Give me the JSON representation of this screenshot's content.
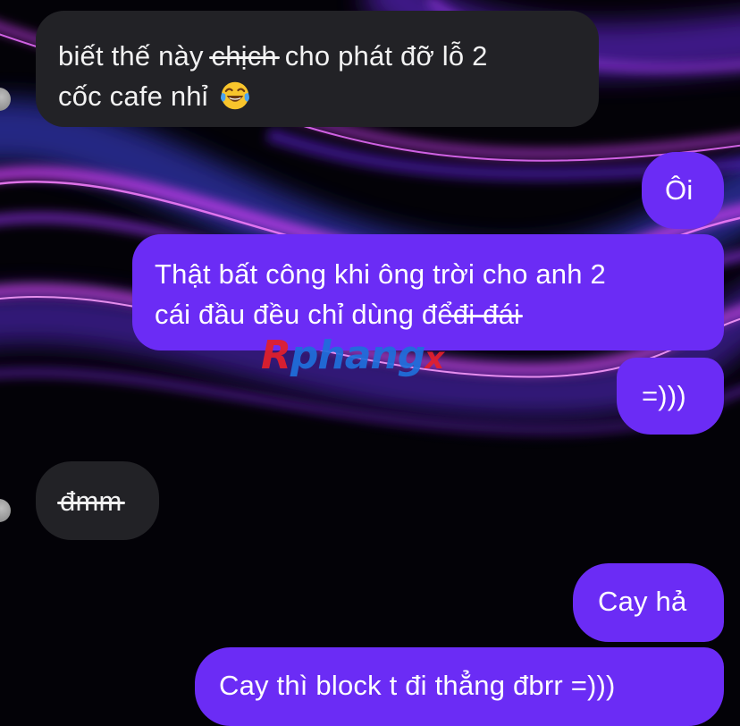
{
  "messages": [
    {
      "id": "m1",
      "direction": "incoming",
      "line1": {
        "before": "biết thế này ",
        "struck": "chịch",
        "after": " cho phát đỡ lỗ 2"
      },
      "line2": {
        "text": "cốc cafe nhỉ",
        "emoji": "face-with-tears-of-joy"
      }
    },
    {
      "id": "m2",
      "direction": "outgoing",
      "text": "Ôi"
    },
    {
      "id": "m3",
      "direction": "outgoing",
      "line1": "Thật bất công khi ông trời cho anh 2",
      "line2": {
        "before": "cái đầu đều chỉ dùng để",
        "struck": " đi đái"
      }
    },
    {
      "id": "m4",
      "direction": "outgoing",
      "text": "=)))"
    },
    {
      "id": "m5",
      "direction": "incoming",
      "struck": "đmm"
    },
    {
      "id": "m6",
      "direction": "outgoing",
      "text": "Cay hả"
    },
    {
      "id": "m7",
      "direction": "outgoing",
      "text": "Cay thì block t đi thẳng đbrr =)))"
    }
  ],
  "watermark": {
    "part1": "R",
    "part2": "phang",
    "part3": "x"
  },
  "colors": {
    "outgoing_bubble": "#6b2cf5",
    "incoming_bubble": "#222226",
    "background": "#030207",
    "wallpaper_magenta": "#c83cf0",
    "wallpaper_violet": "#5a1fd0",
    "wallpaper_blue": "#2a2f9a",
    "watermark_red": "#e3202b",
    "watermark_blue": "#1f6fdc"
  }
}
